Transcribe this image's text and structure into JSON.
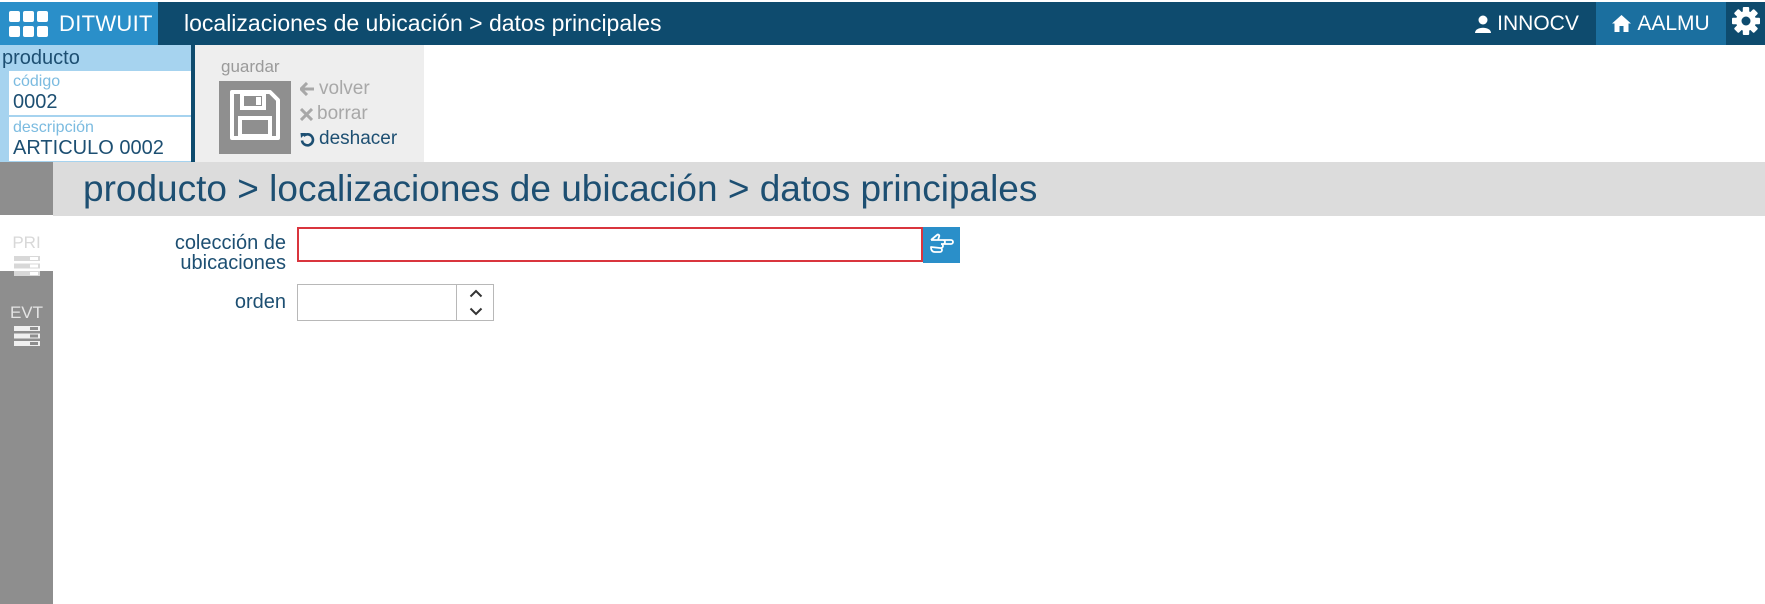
{
  "app": {
    "brand": "DITWUIT",
    "title": "localizaciones de ubicación > datos principales",
    "user": "INNOCV",
    "home": "AALMU"
  },
  "context": {
    "heading": "producto",
    "fields": [
      {
        "label": "código",
        "value": "0002"
      },
      {
        "label": "descripción",
        "value": "ARTICULO 0002"
      }
    ]
  },
  "actions": {
    "save": "guardar",
    "back": "volver",
    "delete": "borrar",
    "undo": "deshacer"
  },
  "rail": {
    "items": [
      {
        "label": "PRI",
        "icon": "list-icon"
      },
      {
        "label": "EVT",
        "icon": "list-icon"
      }
    ]
  },
  "page": {
    "title": "producto > localizaciones de ubicación > datos principales"
  },
  "form": {
    "collection_label_line1": "colección de",
    "collection_label_line2": "ubicaciones",
    "collection_value": "",
    "order_label": "orden",
    "order_value": ""
  },
  "colors": {
    "topbar": "#0e4b6e",
    "brand": "#2a8fc9",
    "accent_text": "#1d4f72",
    "error_border": "#d9353e"
  }
}
